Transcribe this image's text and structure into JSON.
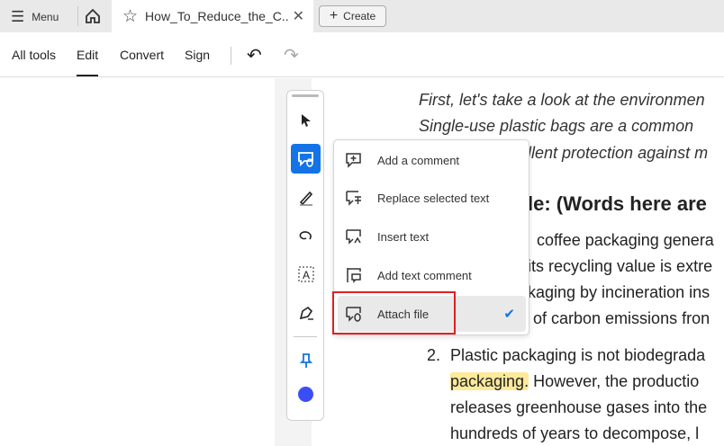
{
  "tabbar": {
    "menu_label": "Menu",
    "tab_title": "How_To_Reduce_the_C..",
    "create_label": "Create"
  },
  "toolbar": {
    "items": [
      "All tools",
      "Edit",
      "Convert",
      "Sign"
    ],
    "active": "Edit"
  },
  "document": {
    "lines": [
      "First, let's take a look at the environmen",
      "Single-use plastic bags are a common",
      "llent protection against m"
    ],
    "heading": "le: (Words here are",
    "body": [
      "coffee packaging genera",
      "its recycling value is extre",
      "kaging by incineration ins",
      "of carbon emissions fron"
    ],
    "list_num": "2.",
    "list": [
      "Plastic packaging is not biodegrada",
      "However, the productio",
      "releases greenhouse gases into the",
      "hundreds of years to decompose, l"
    ],
    "highlight": "packaging."
  },
  "dropdown": {
    "items": [
      "Add a comment",
      "Replace selected text",
      "Insert text",
      "Add text comment",
      "Attach file"
    ],
    "selected": "Attach file"
  },
  "colors": {
    "accent": "#1473e6",
    "annotation_color": "#3b4ef5",
    "highlight": "#fce99a",
    "red_box": "#e02020"
  }
}
